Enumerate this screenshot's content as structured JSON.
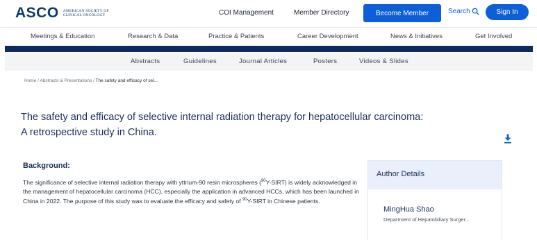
{
  "header": {
    "logo": {
      "word": "ASCO",
      "line1": "AMERICAN SOCIETY OF",
      "line2": "CLINICAL ONCOLOGY"
    },
    "links": [
      "COI Management",
      "Member Directory"
    ],
    "cta_label": "Become Member",
    "search_label": "Search",
    "signin_label": "Sign In"
  },
  "main_nav": [
    "Meetings & Education",
    "Research & Data",
    "Practice & Patients",
    "Career Development",
    "News & Initiatives",
    "Get Involved"
  ],
  "sub_nav": [
    "Abstracts",
    "Guidelines",
    "Journal Articles",
    "Posters",
    "Videos & Slides"
  ],
  "breadcrumb": {
    "home": "Home",
    "sep": "/",
    "section": "Abstracts & Presentations",
    "current": "The safety and efficacy of sel..."
  },
  "article": {
    "title_line1": "The safety and efficacy of selective internal radiation therapy for hepatocellular carcinoma:",
    "title_line2": "A retrospective study in China.",
    "background_heading": "Background:",
    "background_text_1": "The significance of selective internal radiation therapy with yttrium-90 resin microspheres (",
    "sup_1": "90",
    "background_text_2": "Y-SIRT) is widely acknowledged in the management of hepatocellular carcinoma (HCC), especially the application in advanced HCCs, which has been launched in China in 2022. The purpose of this study was to evaluate the efficacy and safety of ",
    "sup_2": "90",
    "background_text_3": "Y-SIRT in Chinese patients."
  },
  "author_details": {
    "heading": "Author Details",
    "name": "MingHua Shao",
    "department": "Department of Hepatobiliary Surger..."
  },
  "colors": {
    "brand_blue": "#0c5fd6",
    "navy": "#0d2b5e",
    "title": "#1a2e55"
  }
}
